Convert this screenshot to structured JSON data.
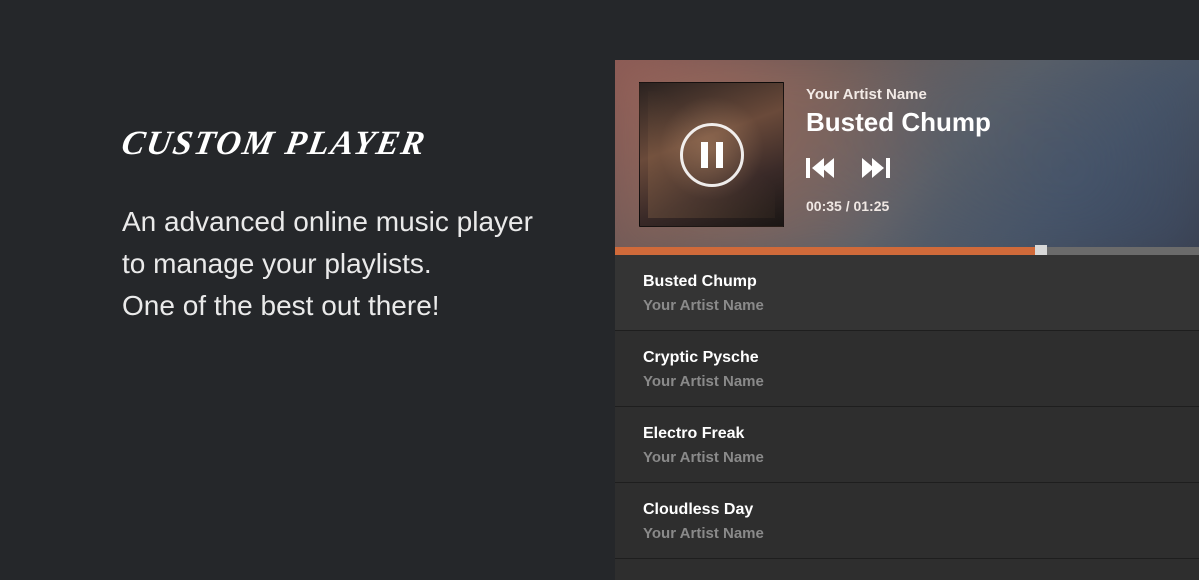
{
  "left": {
    "heading": "CUSTOM PLAYER",
    "desc_line1": "An advanced online music player to manage your playlists.",
    "desc_line2": "One of the best out there!"
  },
  "player": {
    "artist": "Your Artist Name",
    "track": "Busted Chump",
    "time": "00:35 / 01:25",
    "progress_percent": 73
  },
  "playlist": [
    {
      "title": "Busted Chump",
      "artist": "Your Artist Name"
    },
    {
      "title": "Cryptic Pysche",
      "artist": "Your Artist Name"
    },
    {
      "title": "Electro Freak",
      "artist": "Your Artist Name"
    },
    {
      "title": "Cloudless Day",
      "artist": "Your Artist Name"
    }
  ],
  "colors": {
    "accent": "#d06a3a",
    "bg": "#25272a"
  }
}
